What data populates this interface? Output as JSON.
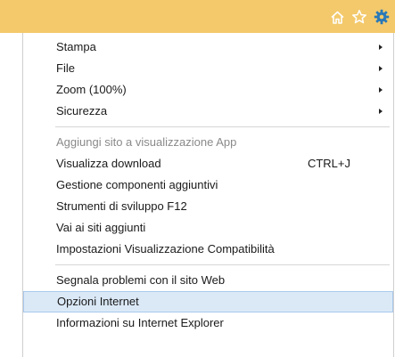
{
  "toolbar": {
    "icons": [
      "home-icon",
      "star-icon",
      "gear-icon"
    ],
    "accent_color": "#f3c96b",
    "gear_color": "#2a79b8"
  },
  "menu": {
    "group1": [
      {
        "label": "Stampa",
        "submenu": true
      },
      {
        "label": "File",
        "submenu": true
      },
      {
        "label": "Zoom (100%)",
        "submenu": true
      },
      {
        "label": "Sicurezza",
        "submenu": true
      }
    ],
    "group2": [
      {
        "label": "Aggiungi sito a visualizzazione App",
        "disabled": true
      },
      {
        "label": "Visualizza download",
        "shortcut": "CTRL+J"
      },
      {
        "label": "Gestione componenti aggiuntivi"
      },
      {
        "label": "Strumenti di sviluppo F12"
      },
      {
        "label": "Vai ai siti aggiunti"
      },
      {
        "label": "Impostazioni Visualizzazione Compatibilità"
      }
    ],
    "group3": [
      {
        "label": "Segnala problemi con il sito Web"
      },
      {
        "label": "Opzioni Internet",
        "highlighted": true
      },
      {
        "label": "Informazioni su Internet Explorer"
      }
    ]
  }
}
